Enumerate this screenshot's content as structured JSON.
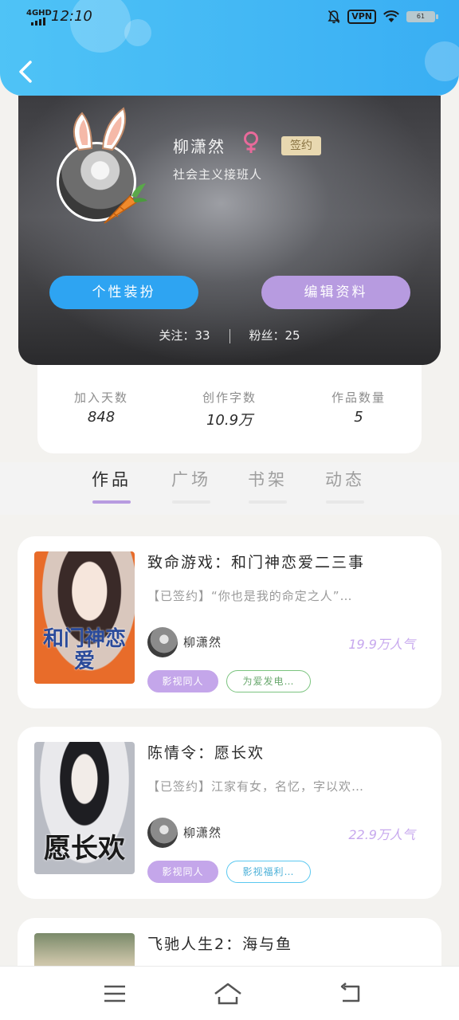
{
  "status_bar": {
    "network": "4GHD",
    "time": "12:10",
    "vpn": "VPN",
    "battery": "61"
  },
  "profile": {
    "name": "柳潇然",
    "gender_icon": "female-icon",
    "signed_badge": "签约",
    "bio": "社会主义接班人",
    "outfit_button": "个性装扮",
    "edit_button": "编辑资料",
    "following_label": "关注：33",
    "followers_label": "粉丝：25"
  },
  "stats": [
    {
      "label": "加入天数",
      "value": "848"
    },
    {
      "label": "创作字数",
      "value": "10.9万"
    },
    {
      "label": "作品数量",
      "value": "5"
    }
  ],
  "tabs": [
    {
      "label": "作品",
      "active": true
    },
    {
      "label": "广场",
      "active": false
    },
    {
      "label": "书架",
      "active": false
    },
    {
      "label": "动态",
      "active": false
    }
  ],
  "works": [
    {
      "title": "致命游戏：和门神恋爱二三事",
      "desc": "【已签约】“你也是我的命定之人”…",
      "author": "柳潇然",
      "popularity": "19.9万人气",
      "cover_text": "和门神恋爱",
      "tags": [
        {
          "label": "影视同人",
          "color": "#c4a6ea"
        },
        {
          "label": "为爱发电…",
          "color": "#7bc47f"
        }
      ]
    },
    {
      "title": "陈情令：愿长欢",
      "desc": "【已签约】江家有女，名忆，字以欢…",
      "author": "柳潇然",
      "popularity": "22.9万人气",
      "cover_text": "愿长欢",
      "tags": [
        {
          "label": "影视同人",
          "color": "#c4a6ea"
        },
        {
          "label": "影视福利…",
          "color": "#5ac8f0"
        }
      ]
    },
    {
      "title": "飞驰人生2：海与鱼"
    }
  ],
  "colors": {
    "header": "#3db5f4",
    "accent_purple": "#b79be0",
    "accent_blue": "#2ea4f2",
    "badge_gold": "#e8d8b0"
  },
  "nav": {
    "menu_icon": "menu-icon",
    "home_icon": "home-icon",
    "back_icon": "back-icon"
  }
}
